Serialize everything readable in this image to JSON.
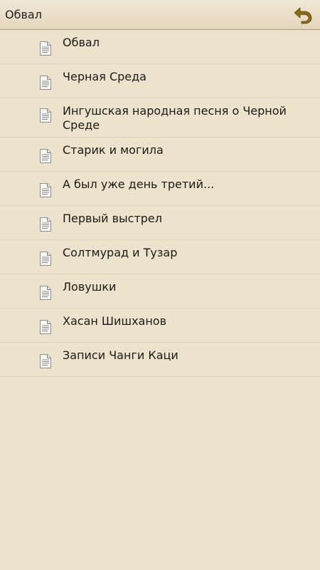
{
  "header": {
    "title": "Обвал",
    "back_icon": "undo-arrow-icon",
    "back_icon_color": "#8a6a12"
  },
  "list": {
    "item_icon": "document-icon",
    "items": [
      {
        "label": "Обвал"
      },
      {
        "label": "Черная Среда"
      },
      {
        "label": "Ингушская народная песня о Черной Среде"
      },
      {
        "label": "Старик и могила"
      },
      {
        "label": "А был уже день третий..."
      },
      {
        "label": "Первый выстрел"
      },
      {
        "label": "Солтмурад и Тузар"
      },
      {
        "label": "Ловушки"
      },
      {
        "label": "Хасан Шишханов"
      },
      {
        "label": "Записи Чанги Каци"
      }
    ]
  },
  "colors": {
    "background": "#ede2cb",
    "divider": "#e0d4bd"
  }
}
